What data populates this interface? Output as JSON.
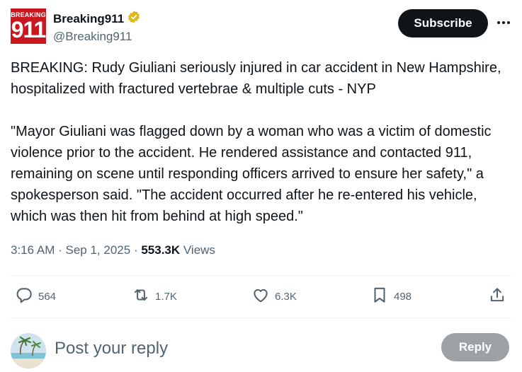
{
  "author": {
    "display_name": "Breaking911",
    "handle": "@Breaking911",
    "avatar_text_top": "BREAKING",
    "avatar_text_main": "911",
    "avatar_color": "#c8171e",
    "verified_badge_color": "#e2b719"
  },
  "header": {
    "subscribe_label": "Subscribe",
    "more_icon": "more-horizontal-icon"
  },
  "tweet": {
    "paragraph_1": "BREAKING: Rudy Giuliani seriously injured in car accident in New Hampshire, hospitalized with fractured vertebrae & multiple cuts - NYP",
    "paragraph_2": "\"Mayor Giuliani was flagged down by a woman who was a victim of domestic violence prior to the accident. He rendered assistance and contacted 911, remaining on scene until responding officers arrived to ensure her safety,\" a spokesperson said. \"The accident occurred after he re-entered his vehicle, which was then hit from behind at high speed.\""
  },
  "meta": {
    "time": "3:16 AM",
    "date": "Sep 1, 2025",
    "views_count": "553.3K",
    "views_label": "Views"
  },
  "actions": {
    "replies": "564",
    "reposts": "1.7K",
    "likes": "6.3K",
    "bookmarks": "498"
  },
  "reply_box": {
    "placeholder": "Post your reply",
    "button_label": "Reply"
  }
}
